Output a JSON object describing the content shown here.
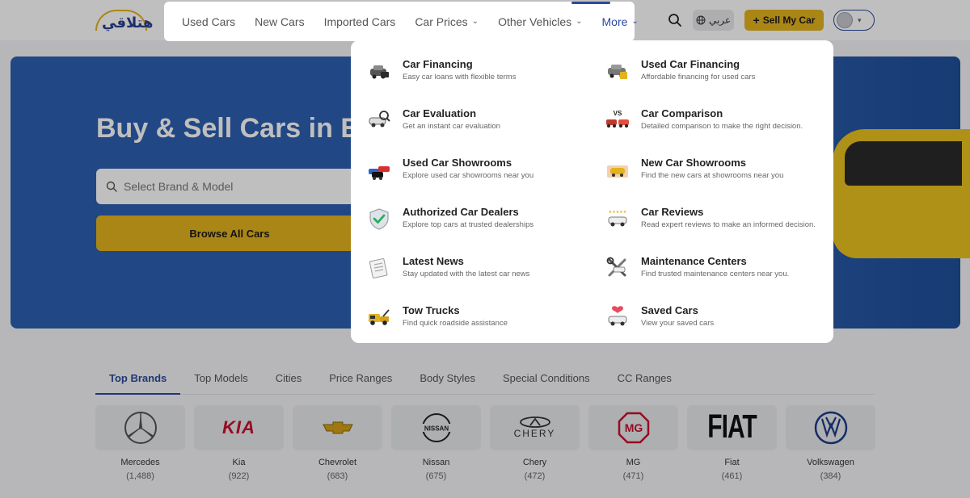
{
  "nav": {
    "items": [
      {
        "label": "Used Cars",
        "has_chevron": false
      },
      {
        "label": "New Cars",
        "has_chevron": false
      },
      {
        "label": "Imported Cars",
        "has_chevron": false
      },
      {
        "label": "Car Prices",
        "has_chevron": true
      },
      {
        "label": "Other Vehicles",
        "has_chevron": true
      },
      {
        "label": "More",
        "has_chevron": true,
        "active": true
      }
    ]
  },
  "header": {
    "logo_text": "هتلاقي",
    "lang_label": "عربي",
    "sell_label": "Sell My Car"
  },
  "hero": {
    "title": "Buy & Sell Cars in Eg",
    "search_placeholder": "Select Brand & Model",
    "browse_label": "Browse All Cars"
  },
  "dropdown": {
    "items": [
      {
        "title": "Car Financing",
        "desc": "Easy car loans with flexible terms",
        "icon": "car-financing-icon"
      },
      {
        "title": "Used Car Financing",
        "desc": "Affordable financing for used cars",
        "icon": "used-car-financing-icon"
      },
      {
        "title": "Car Evaluation",
        "desc": "Get an instant car evaluation",
        "icon": "car-evaluation-icon"
      },
      {
        "title": "Car Comparison",
        "desc": "Detailed comparison to make the right decision.",
        "icon": "car-comparison-icon"
      },
      {
        "title": "Used Car Showrooms",
        "desc": "Explore used car showrooms near you",
        "icon": "used-showrooms-icon"
      },
      {
        "title": "New Car Showrooms",
        "desc": "Find the new cars at showrooms near you",
        "icon": "new-showrooms-icon"
      },
      {
        "title": "Authorized Car Dealers",
        "desc": "Explore top cars at trusted dealerships",
        "icon": "shield-check-icon"
      },
      {
        "title": "Car Reviews",
        "desc": "Read expert reviews to make an informed decision.",
        "icon": "car-reviews-icon"
      },
      {
        "title": "Latest News",
        "desc": "Stay updated with the latest car news",
        "icon": "news-icon"
      },
      {
        "title": "Maintenance Centers",
        "desc": "Find trusted maintenance centers near you.",
        "icon": "tools-icon"
      },
      {
        "title": "Tow Trucks",
        "desc": "Find quick roadside assistance",
        "icon": "tow-truck-icon"
      },
      {
        "title": "Saved Cars",
        "desc": "View your saved cars",
        "icon": "saved-cars-icon"
      }
    ],
    "comparison_badge": "VS",
    "reviews_stars": "★★★★★"
  },
  "tabs": [
    {
      "label": "Top Brands",
      "active": true
    },
    {
      "label": "Top Models"
    },
    {
      "label": "Cities"
    },
    {
      "label": "Price Ranges"
    },
    {
      "label": "Body Styles"
    },
    {
      "label": "Special Conditions"
    },
    {
      "label": "CC Ranges"
    }
  ],
  "brands": [
    {
      "name": "Mercedes",
      "count": "(1,488)"
    },
    {
      "name": "Kia",
      "count": "(922)"
    },
    {
      "name": "Chevrolet",
      "count": "(683)"
    },
    {
      "name": "Nissan",
      "count": "(675)"
    },
    {
      "name": "Chery",
      "count": "(472)"
    },
    {
      "name": "MG",
      "count": "(471)"
    },
    {
      "name": "Fiat",
      "count": "(461)"
    },
    {
      "name": "Volkswagen",
      "count": "(384)"
    }
  ],
  "brand_logos": {
    "kia": "KIA",
    "nissan": "NISSAN",
    "chery": "CHERY",
    "mg": "MG",
    "fiat": "FIAT",
    "vw": "VW"
  },
  "colors": {
    "primary_blue": "#2b4a9b",
    "accent_yellow": "#e3b31e",
    "hero_blue": "#2c5fb0"
  }
}
